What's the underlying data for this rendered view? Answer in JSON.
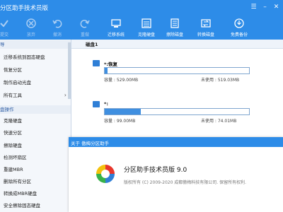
{
  "window": {
    "title": "分区助手技术员版"
  },
  "toolbar": {
    "left_items": [
      {
        "label": "提交",
        "icon": "submit-icon"
      },
      {
        "label": "放弃",
        "icon": "discard-icon"
      },
      {
        "label": "撤消",
        "icon": "undo-icon"
      },
      {
        "label": "重做",
        "icon": "redo-icon"
      }
    ],
    "right_items": [
      {
        "label": "迁移系统",
        "icon": "migrate-system-icon"
      },
      {
        "label": "克隆硬盘",
        "icon": "clone-disk-icon"
      },
      {
        "label": "擦除磁盘",
        "icon": "wipe-disk-icon"
      },
      {
        "label": "转换磁盘",
        "icon": "convert-disk-icon"
      },
      {
        "label": "免费备份",
        "icon": "free-backup-icon"
      }
    ]
  },
  "sidebar": {
    "section1_header": "导",
    "section1_items": [
      "迁移系统到固态硬盘",
      "恢复分区",
      "制作启动光盘",
      "所有工具"
    ],
    "section2_header": "盘操作",
    "section2_items": [
      "克隆硬盘",
      "快速分区",
      "擦除硬盘",
      "检测坏扇区",
      "重建MBR",
      "删除所有分区",
      "转换成MBR硬盘",
      "安全擦除固态硬盘"
    ]
  },
  "main": {
    "disk_label": "磁盘1",
    "partitions": [
      {
        "name": "*:恢复",
        "capacity": "容量 : 529.00MB",
        "free": "未使用 : 519.03MB",
        "used_fraction": 0.02
      },
      {
        "name": "*:",
        "capacity": "容量 : 99.00MB",
        "free": "未使用 : 74.01MB",
        "used_fraction": 0.25
      }
    ]
  },
  "about": {
    "title": "关于 傲梅分区助手",
    "app_name": "分区助手技术员版 9.0",
    "copyright": "版权所有 (C) 2009-2020 成都傲梅科技有限公司. 保留所有权利."
  },
  "colors": {
    "accent": "#2d8ce8"
  }
}
